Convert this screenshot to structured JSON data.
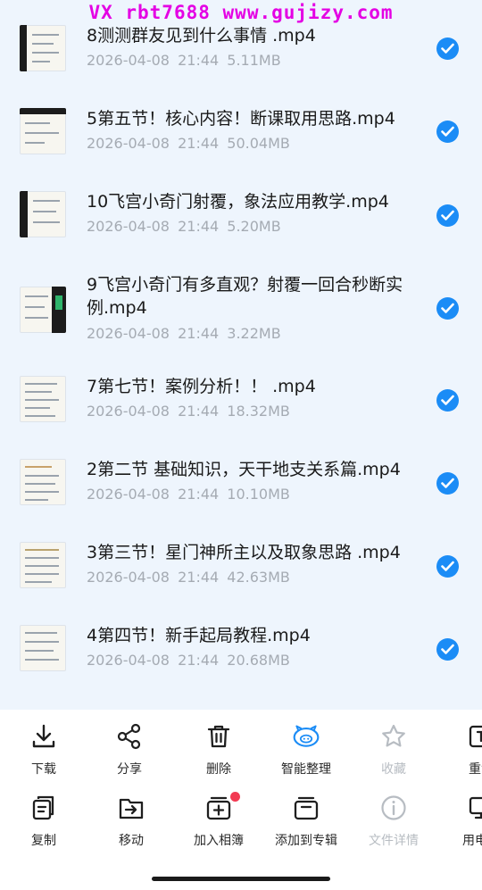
{
  "watermark": "VX rbt7688  www.gujizy.com",
  "files": [
    {
      "name": "8测测群友见到什么事情 .mp4",
      "date": "2026-04-08",
      "time": "21:44",
      "size": "5.11MB",
      "selected": true
    },
    {
      "name": "5第五节！核心内容！断课取用思路.mp4",
      "date": "2026-04-08",
      "time": "21:44",
      "size": "50.04MB",
      "selected": true
    },
    {
      "name": "10飞宫小奇门射覆，象法应用教学.mp4",
      "date": "2026-04-08",
      "time": "21:44",
      "size": "5.20MB",
      "selected": true
    },
    {
      "name": "9飞宫小奇门有多直观？射覆一回合秒断实例.mp4",
      "date": "2026-04-08",
      "time": "21:44",
      "size": "3.22MB",
      "selected": true
    },
    {
      "name": "7第七节！案例分析！！ .mp4",
      "date": "2026-04-08",
      "time": "21:44",
      "size": "18.32MB",
      "selected": true
    },
    {
      "name": "2第二节  基础知识，天干地支关系篇.mp4",
      "date": "2026-04-08",
      "time": "21:44",
      "size": "10.10MB",
      "selected": true
    },
    {
      "name": "3第三节！星门神所主以及取象思路 .mp4",
      "date": "2026-04-08",
      "time": "21:44",
      "size": "42.63MB",
      "selected": true
    },
    {
      "name": "4第四节！新手起局教程.mp4",
      "date": "2026-04-08",
      "time": "21:44",
      "size": "20.68MB",
      "selected": true
    }
  ],
  "toolbar": {
    "row1": [
      {
        "label": "下载",
        "icon": "download-icon"
      },
      {
        "label": "分享",
        "icon": "share-icon"
      },
      {
        "label": "删除",
        "icon": "trash-icon"
      },
      {
        "label": "智能整理",
        "icon": "smart-organize-icon",
        "accent": "#1b8cf6"
      },
      {
        "label": "收藏",
        "icon": "star-icon",
        "disabled": true
      },
      {
        "label": "重命",
        "icon": "rename-icon"
      }
    ],
    "row2": [
      {
        "label": "复制",
        "icon": "copy-icon"
      },
      {
        "label": "移动",
        "icon": "move-icon"
      },
      {
        "label": "加入相簿",
        "icon": "add-album-icon",
        "badge": true
      },
      {
        "label": "添加到专辑",
        "icon": "add-to-collection-icon"
      },
      {
        "label": "文件详情",
        "icon": "info-icon",
        "disabled": true
      },
      {
        "label": "用电脑",
        "icon": "computer-icon"
      }
    ]
  },
  "colors": {
    "accent": "#1b8cf6",
    "badge": "#f23a52",
    "watermark": "#e400e4"
  }
}
